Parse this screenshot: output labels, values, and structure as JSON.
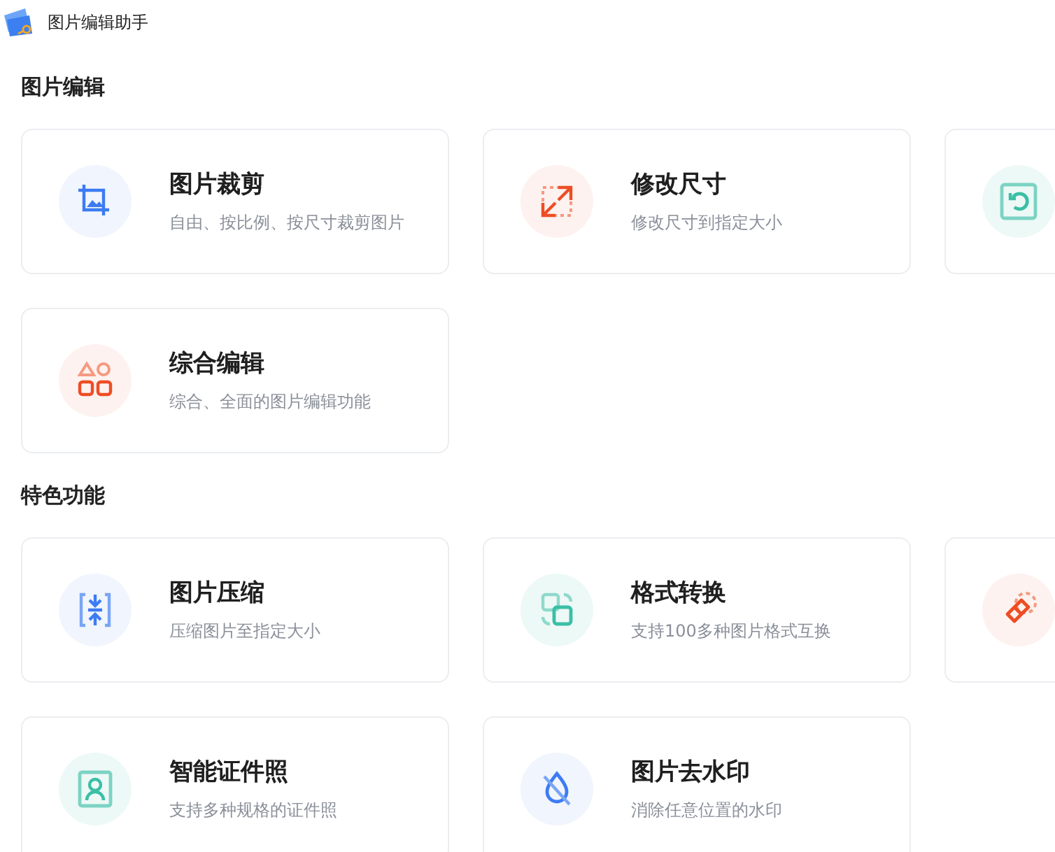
{
  "window": {
    "title": "图片编辑助手"
  },
  "sections": [
    {
      "title": "图片编辑",
      "cards": [
        {
          "kind": "crop",
          "title": "图片裁剪",
          "description": "自由、按比例、按尺寸裁剪图片"
        },
        {
          "kind": "resize",
          "title": "修改尺寸",
          "description": "修改尺寸到指定大小"
        },
        {
          "kind": "rotate"
        },
        {
          "kind": "shapes",
          "title": "综合编辑",
          "description": "综合、全面的图片编辑功能"
        }
      ]
    },
    {
      "title": "特色功能",
      "cards": [
        {
          "kind": "compress",
          "title": "图片压缩",
          "description": "压缩图片至指定大小"
        },
        {
          "kind": "convert",
          "title": "格式转换",
          "description": "支持100多种图片格式互换"
        },
        {
          "kind": "eraser"
        },
        {
          "kind": "portrait",
          "title": "智能证件照",
          "description": "支持多种规格的证件照"
        },
        {
          "kind": "nodrop",
          "title": "图片去水印",
          "description": "消除任意位置的水印"
        }
      ]
    }
  ]
}
